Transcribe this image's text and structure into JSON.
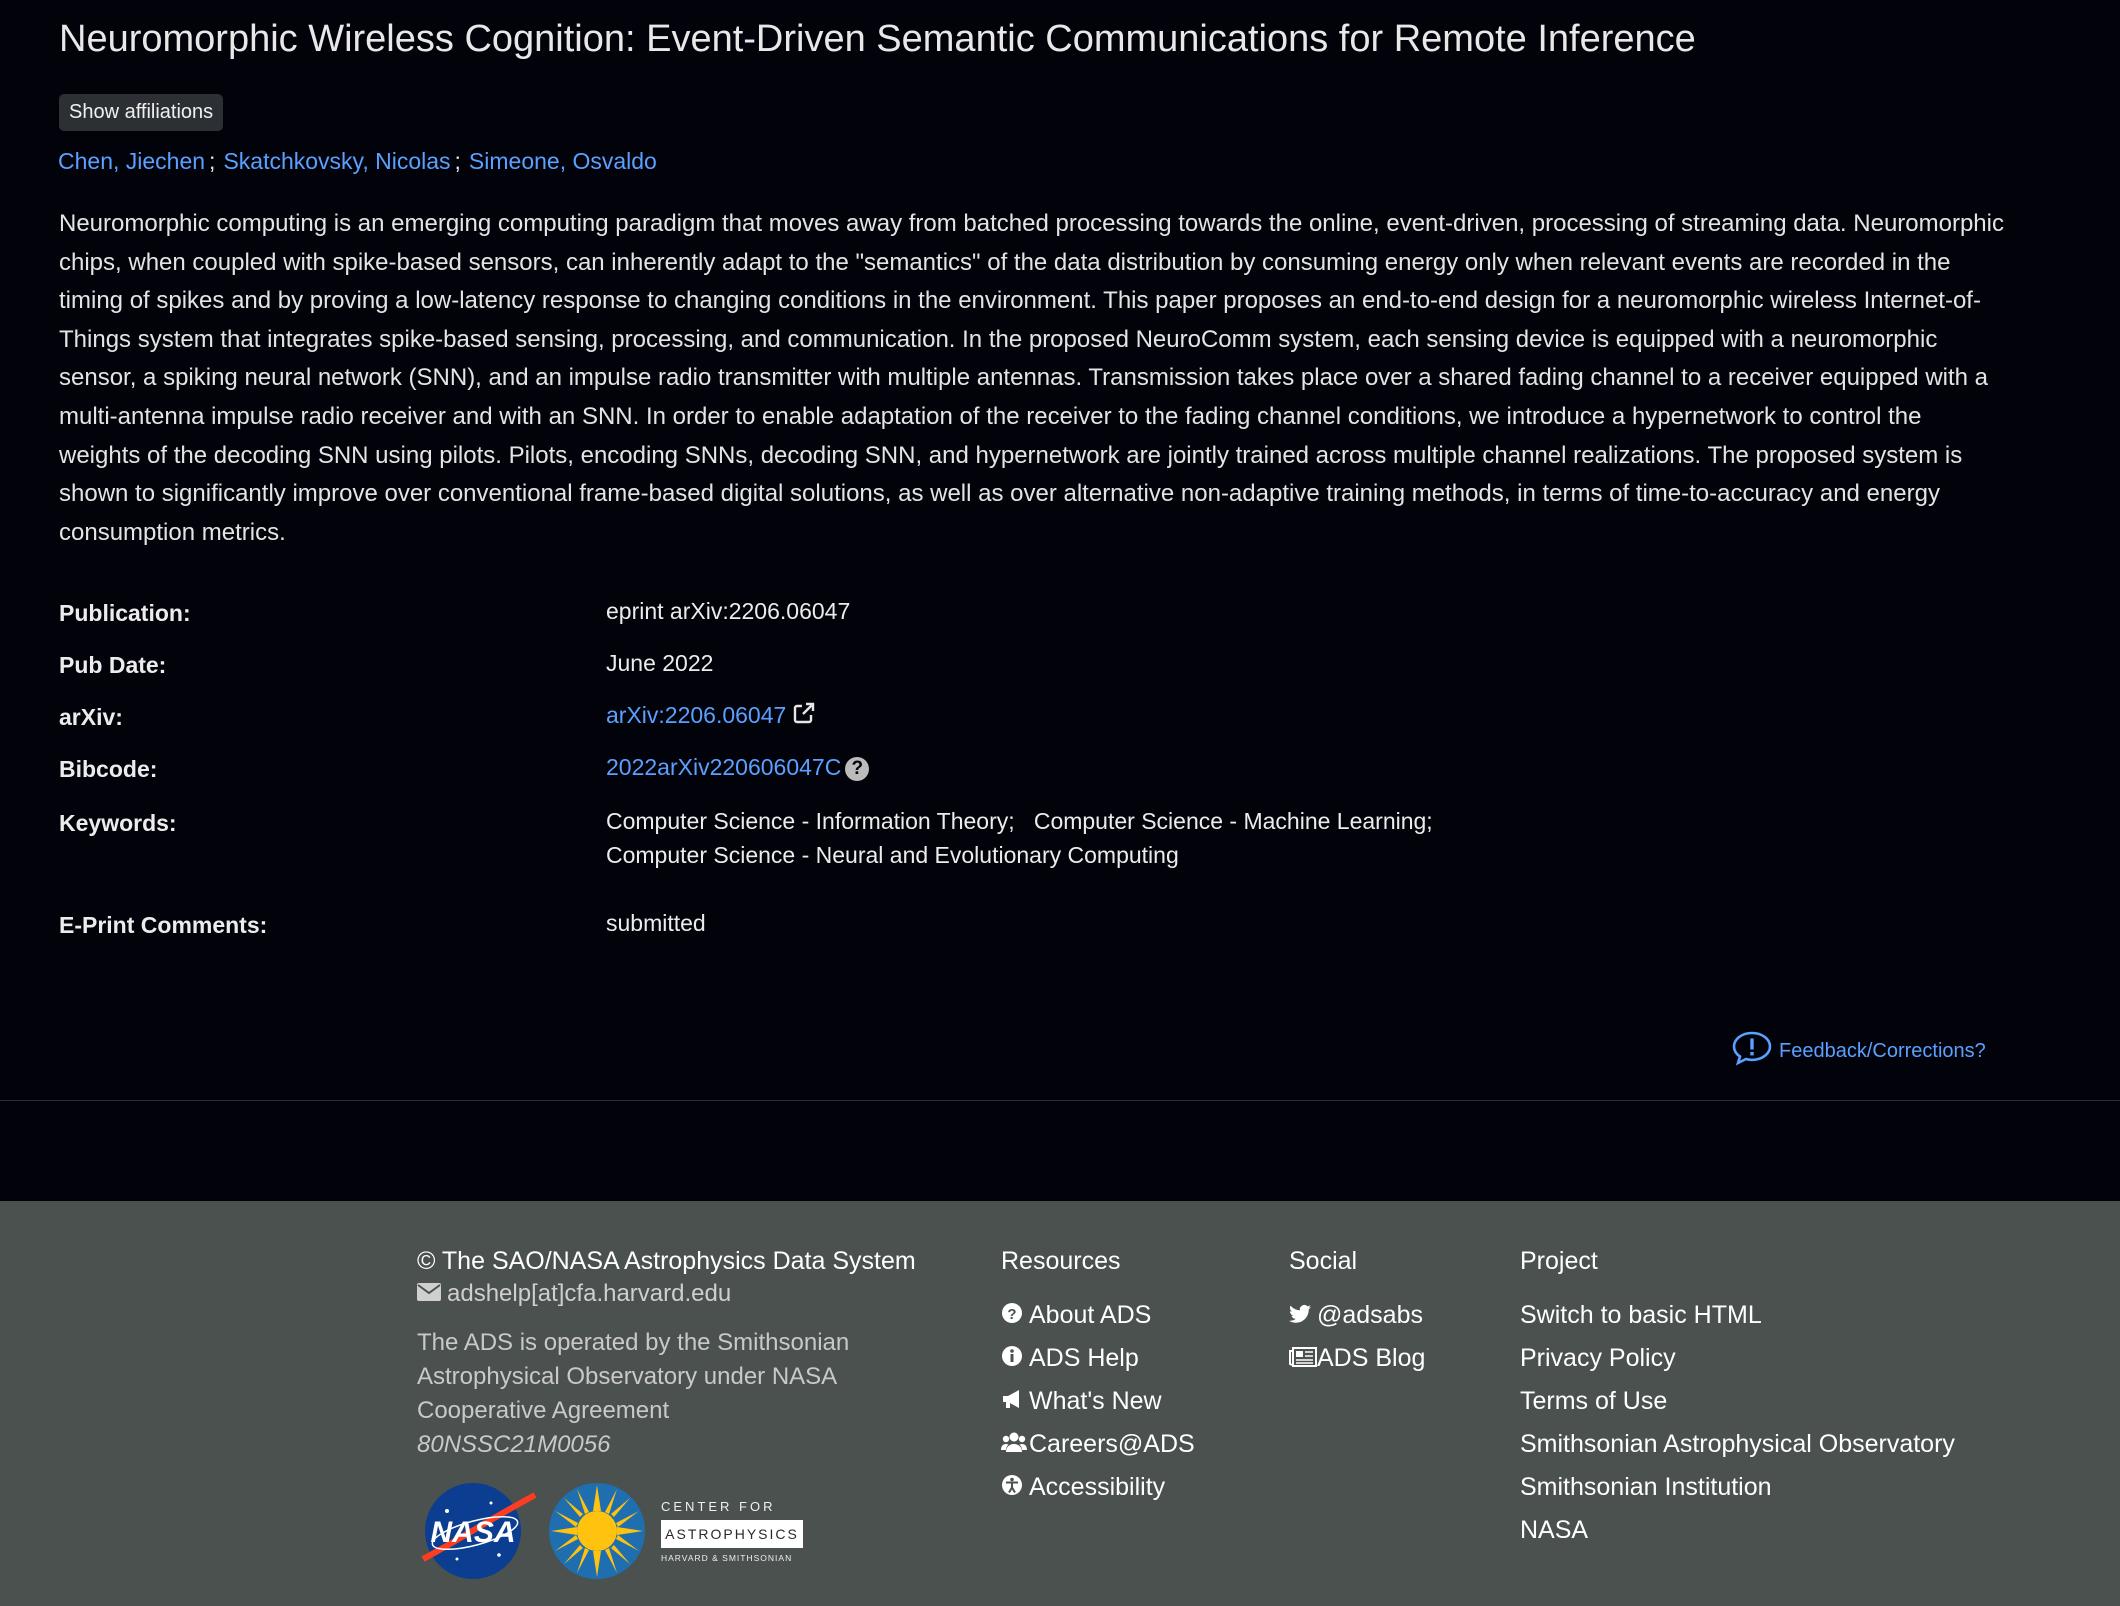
{
  "title": "Neuromorphic Wireless Cognition: Event-Driven Semantic Communications for Remote Inference",
  "affiliations_button": "Show affiliations",
  "authors": [
    "Chen, Jiechen",
    "Skatchkovsky, Nicolas",
    "Simeone, Osvaldo"
  ],
  "author_separator": ";",
  "abstract": "Neuromorphic computing is an emerging computing paradigm that moves away from batched processing towards the online, event-driven, processing of streaming data. Neuromorphic chips, when coupled with spike-based sensors, can inherently adapt to the \"semantics\" of the data distribution by consuming energy only when relevant events are recorded in the timing of spikes and by proving a low-latency response to changing conditions in the environment. This paper proposes an end-to-end design for a neuromorphic wireless Internet-of-Things system that integrates spike-based sensing, processing, and communication. In the proposed NeuroComm system, each sensing device is equipped with a neuromorphic sensor, a spiking neural network (SNN), and an impulse radio transmitter with multiple antennas. Transmission takes place over a shared fading channel to a receiver equipped with a multi-antenna impulse radio receiver and with an SNN. In order to enable adaptation of the receiver to the fading channel conditions, we introduce a hypernetwork to control the weights of the decoding SNN using pilots. Pilots, encoding SNNs, decoding SNN, and hypernetwork are jointly trained across multiple channel realizations. The proposed system is shown to significantly improve over conventional frame-based digital solutions, as well as over alternative non-adaptive training methods, in terms of time-to-accuracy and energy consumption metrics.",
  "meta": {
    "publication_label": "Publication:",
    "publication_value": "eprint arXiv:2206.06047",
    "pubdate_label": "Pub Date:",
    "pubdate_value": "June 2022",
    "arxiv_label": "arXiv:",
    "arxiv_value": "arXiv:2206.06047",
    "bibcode_label": "Bibcode:",
    "bibcode_value": "2022arXiv220606047C",
    "keywords_label": "Keywords:",
    "keywords": [
      "Computer Science - Information Theory;",
      "Computer Science - Machine Learning;",
      "Computer Science - Neural and Evolutionary Computing"
    ],
    "comments_label": "E-Print Comments:",
    "comments_value": "submitted"
  },
  "feedback_label": "Feedback/Corrections?",
  "footer": {
    "copyright": "© The SAO/NASA Astrophysics Data System",
    "email": "adshelp[at]cfa.harvard.edu",
    "operated_by": "The ADS is operated by the Smithsonian Astrophysical Observatory under NASA Cooperative Agreement",
    "agreement_number": "80NSSC21M0056",
    "cfa_logo_top": "CENTER FOR",
    "cfa_logo_main": "ASTROPHYSICS",
    "cfa_logo_bottom": "HARVARD & SMITHSONIAN",
    "nasa_logo_text": "NASA",
    "resources_heading": "Resources",
    "resources": [
      {
        "label": "About ADS",
        "icon": "question-circle-icon"
      },
      {
        "label": "ADS Help",
        "icon": "info-circle-icon"
      },
      {
        "label": "What's New",
        "icon": "bullhorn-icon"
      },
      {
        "label": "Careers@ADS",
        "icon": "users-icon"
      },
      {
        "label": "Accessibility",
        "icon": "accessibility-icon"
      }
    ],
    "social_heading": "Social",
    "social": [
      {
        "label": "@adsabs",
        "icon": "twitter-icon"
      },
      {
        "label": "ADS Blog",
        "icon": "newspaper-icon"
      }
    ],
    "project_heading": "Project",
    "project": [
      "Switch to basic HTML",
      "Privacy Policy",
      "Terms of Use",
      "Smithsonian Astrophysical Observatory",
      "Smithsonian Institution",
      "NASA"
    ]
  },
  "colors": {
    "background": "#02030a",
    "link": "#5aa0ff",
    "footer_background": "#4a514f"
  }
}
